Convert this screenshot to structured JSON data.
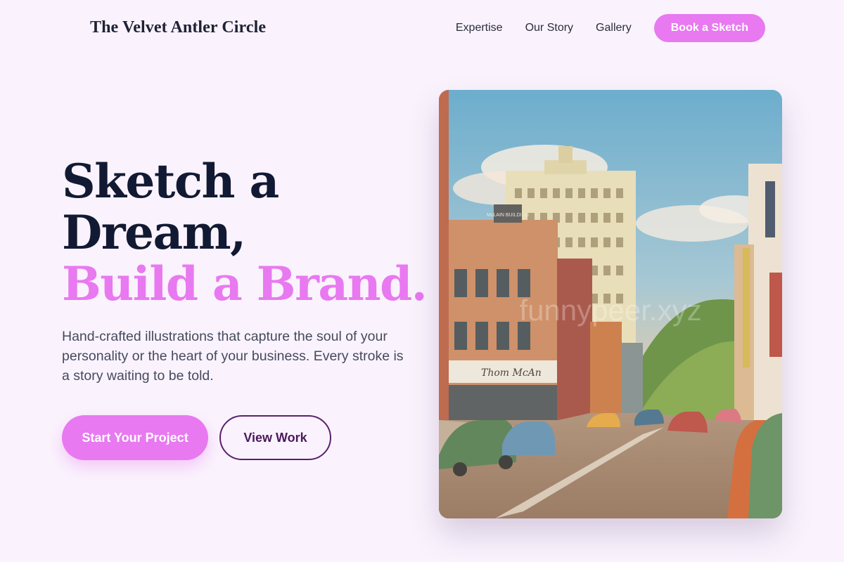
{
  "header": {
    "brand": "The Velvet Antler Circle",
    "nav": [
      {
        "label": "Expertise"
      },
      {
        "label": "Our Story"
      },
      {
        "label": "Gallery"
      }
    ],
    "cta_label": "Book a Sketch"
  },
  "hero": {
    "headline_line1": "Sketch a",
    "headline_line2": "Dream,",
    "headline_accent": "Build a Brand.",
    "description": "Hand-crafted illustrations that capture the soul of your personality or the heart of your business. Every stroke is a story waiting to be told.",
    "primary_button": "Start Your Project",
    "secondary_button": "View Work",
    "image": {
      "watermark": "funnypeer.xyz",
      "sign_building": "McLAIN BUILDING",
      "sign_store": "Thom McAn"
    }
  },
  "colors": {
    "accent": "#e879f0",
    "background": "#faf3fd",
    "dark_text": "#121a33",
    "outline_button": "#5b1f6e"
  }
}
